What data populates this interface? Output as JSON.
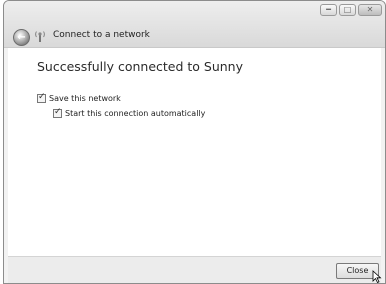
{
  "window": {
    "title": "Connect to a network",
    "caption": {
      "minimize_icon": "minimize-icon",
      "maximize_icon": "maximize-icon",
      "close_icon": "close-icon"
    }
  },
  "main": {
    "heading": "Successfully connected to Sunny",
    "options": [
      {
        "label": "Save this network",
        "checked": true
      },
      {
        "label": "Start this connection automatically",
        "checked": true
      }
    ]
  },
  "footer": {
    "close_label": "Close"
  }
}
